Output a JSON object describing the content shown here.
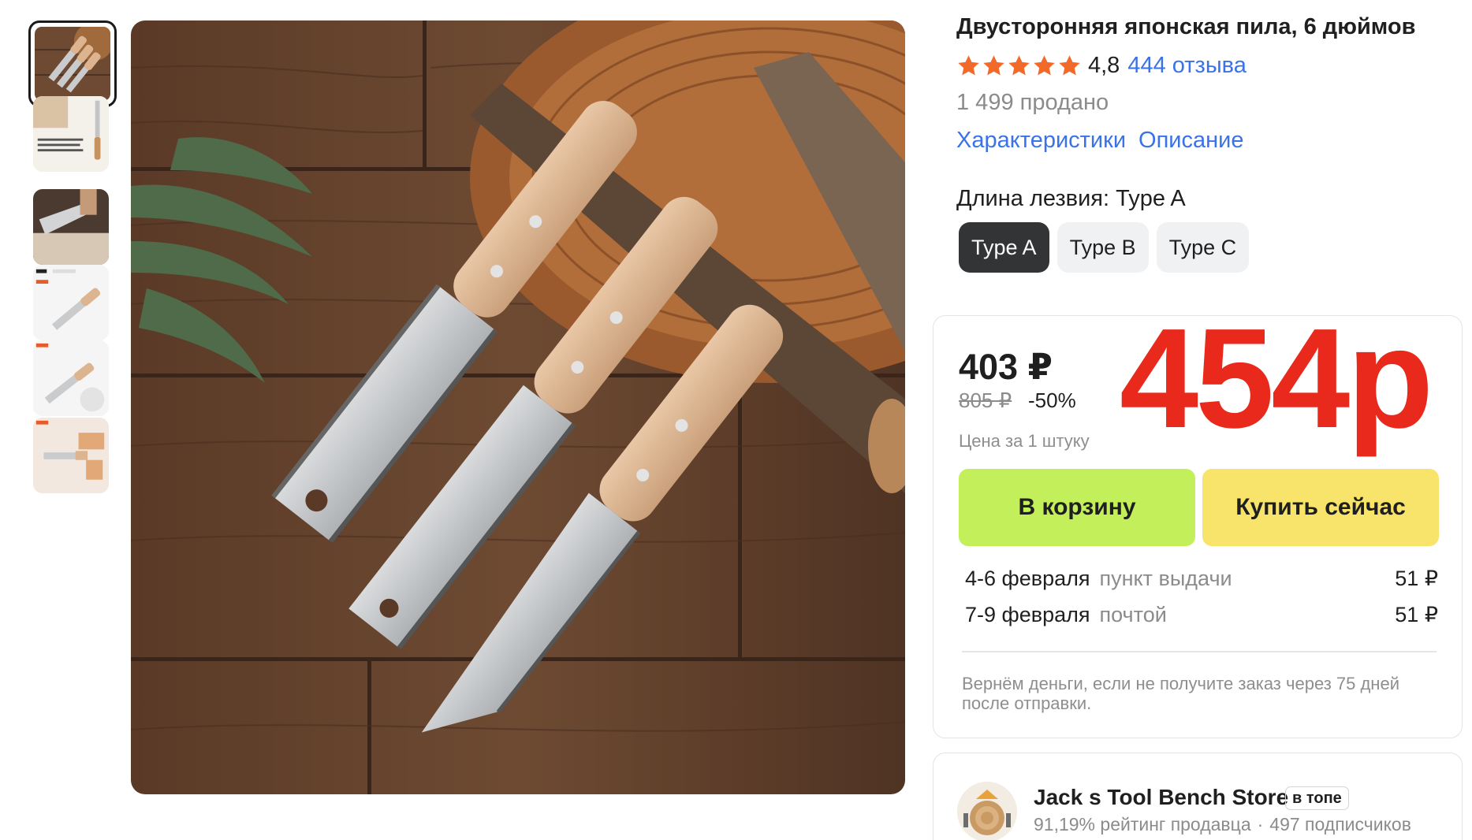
{
  "product": {
    "title": "Двусторонняя японская пила, 6 дюймов",
    "rating": "4,8",
    "stars": 5,
    "reviews_label": "444 отзыва",
    "sold_label": "1 499 продано"
  },
  "tabs": [
    "Характеристики",
    "Описание"
  ],
  "option": {
    "label": "Длина лезвия: Type A",
    "values": [
      "Type A",
      "Type B",
      "Type C"
    ],
    "selected": "Type A"
  },
  "price": {
    "current": "403 ₽",
    "old": "805 ₽",
    "discount": "-50%",
    "unit_note": "Цена за 1 штуку",
    "overlay": "454р"
  },
  "actions": {
    "add_to_cart": "В корзину",
    "buy_now": "Купить сейчас"
  },
  "delivery": [
    {
      "date": "4-6 февраля",
      "method": "пункт выдачи",
      "price": "51 ₽"
    },
    {
      "date": "7-9 февраля",
      "method": "почтой",
      "price": "51 ₽"
    }
  ],
  "guarantee": "Вернём деньги, если не получите заказ через 75 дней после отправки.",
  "store": {
    "name": "Jack s Tool Bench Store",
    "badge": "в топе",
    "rating": "91,19% рейтинг продавца",
    "separator": "·",
    "subscribers": "497 подписчиков"
  },
  "gallery": {
    "thumbnails": [
      "thumbnail-1",
      "thumbnail-2",
      "thumbnail-3",
      "thumbnail-4",
      "thumbnail-5",
      "thumbnail-6"
    ],
    "active": 1
  },
  "colors": {
    "link": "#3a73e8",
    "big_price": "#e8291c",
    "cart_button": "#c2ef5a",
    "buy_button": "#f8e46a",
    "selected_option": "#333436",
    "star": "#f2692a"
  }
}
